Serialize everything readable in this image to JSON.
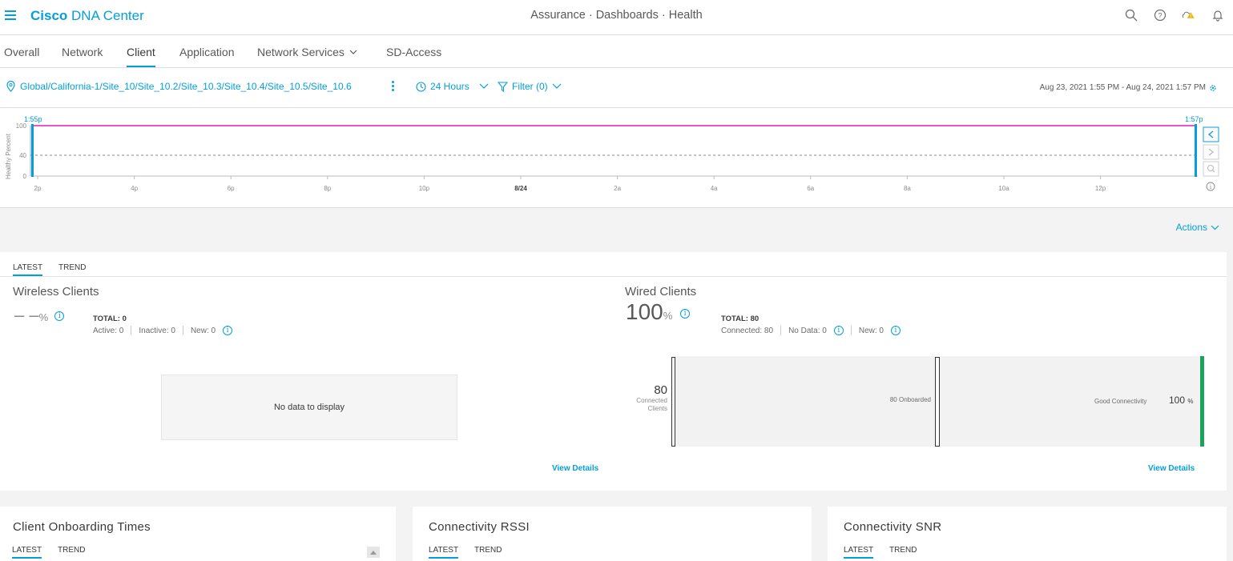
{
  "header": {
    "brand_bold": "Cisco",
    "brand_rest": "DNA Center",
    "breadcrumb": "Assurance · Dashboards · Health"
  },
  "tabs": [
    {
      "label": "Overall"
    },
    {
      "label": "Network"
    },
    {
      "label": "Client"
    },
    {
      "label": "Application"
    },
    {
      "label": "Network Services"
    },
    {
      "label": "SD-Access"
    }
  ],
  "filterbar": {
    "location": "Global/California-1/Site_10/Site_10.2/Site_10.3/Site_10.4/Site_10.5/Site_10.6",
    "time_range": "24 Hours",
    "filter": "Filter (0)",
    "date_range": "Aug 23, 2021 1:55 PM - Aug 24, 2021 1:57 PM"
  },
  "timeline": {
    "ylabel": "Healthy Percent",
    "y_ticks": [
      "100",
      "40",
      "0"
    ],
    "x_ticks": [
      "2p",
      "4p",
      "6p",
      "8p",
      "10p",
      "8/24",
      "2a",
      "4a",
      "6a",
      "8a",
      "10a",
      "12p"
    ],
    "start_label": "1:55p",
    "end_label": "1:57p",
    "health_value": 100,
    "threshold": 40,
    "colors": {
      "line": "#e020b0",
      "handle": "#049fd9"
    }
  },
  "actions_label": "Actions",
  "client_panel": {
    "tabs": [
      "LATEST",
      "TREND"
    ],
    "wireless": {
      "title": "Wireless Clients",
      "value": "– –",
      "unit": "%",
      "total": "TOTAL: 0",
      "active": "Active: 0",
      "inactive": "Inactive: 0",
      "new": "New: 0",
      "no_data": "No data to display",
      "view_details": "View Details"
    },
    "wired": {
      "title": "Wired Clients",
      "value": "100",
      "unit": "%",
      "total": "TOTAL: 80",
      "connected": "Connected: 80",
      "no_data": "No Data: 0",
      "new": "New: 0",
      "funnel_count": "80",
      "funnel_count_label_1": "Connected",
      "funnel_count_label_2": "Clients",
      "onboarded": "80 Onboarded",
      "good_connectivity": "Good Connectivity",
      "good_pct": "100",
      "good_pct_unit": "%",
      "view_details": "View Details",
      "colors": {
        "good": "#1aa35c"
      }
    }
  },
  "bottom_cards": [
    {
      "title": "Client Onboarding Times",
      "tabs": [
        "LATEST",
        "TREND"
      ]
    },
    {
      "title": "Connectivity RSSI",
      "tabs": [
        "LATEST",
        "TREND"
      ]
    },
    {
      "title": "Connectivity SNR",
      "tabs": [
        "LATEST",
        "TREND"
      ]
    }
  ]
}
